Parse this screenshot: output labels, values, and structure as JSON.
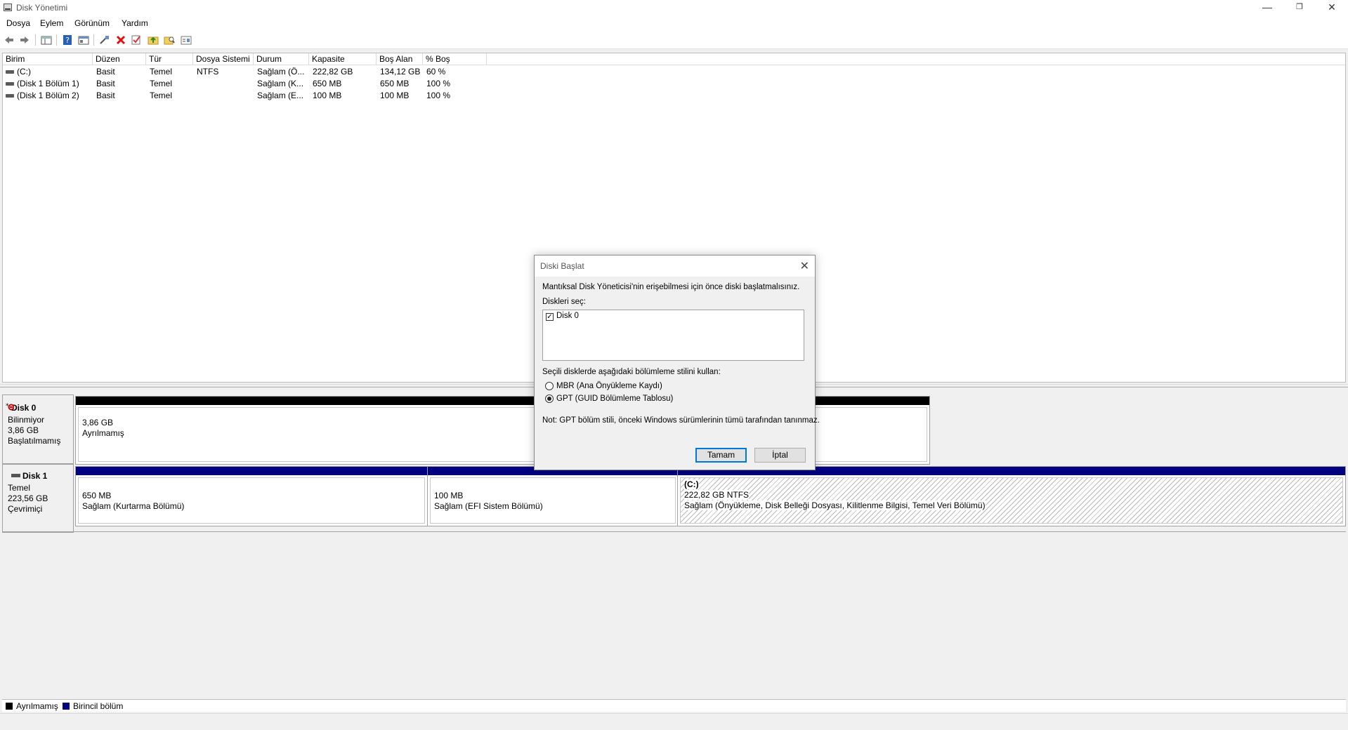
{
  "window": {
    "title": "Disk Yönetimi",
    "minimize_glyph": "—",
    "restore_glyph": "❐",
    "close_glyph": "✕"
  },
  "menu": [
    "Dosya",
    "Eylem",
    "Görünüm",
    "Yardım"
  ],
  "toolbar_icons": [
    "back-icon",
    "forward-icon",
    "console-tree-icon",
    "help-icon",
    "properties-icon",
    "connect-icon",
    "delete-icon",
    "check-icon",
    "up-folder-icon",
    "search-folder-icon",
    "view-icon"
  ],
  "volume_table": {
    "headers": [
      "Birim",
      "Düzen",
      "Tür",
      "Dosya Sistemi",
      "Durum",
      "Kapasite",
      "Boş Alan",
      "% Boş"
    ],
    "rows": [
      [
        "(C:)",
        "Basit",
        "Temel",
        "NTFS",
        "Sağlam (Ö...",
        "222,82 GB",
        "134,12 GB",
        "60 %"
      ],
      [
        "(Disk 1 Bölüm 1)",
        "Basit",
        "Temel",
        "",
        "Sağlam (K...",
        "650 MB",
        "650 MB",
        "100 %"
      ],
      [
        "(Disk 1 Bölüm 2)",
        "Basit",
        "Temel",
        "",
        "Sağlam (E...",
        "100 MB",
        "100 MB",
        "100 %"
      ]
    ]
  },
  "disks": [
    {
      "name": "Disk 0",
      "type": "Bilinmiyor",
      "size": "3,86 GB",
      "status": "Başlatılmamış",
      "partitions": [
        {
          "size": "3,86 GB",
          "label": "Ayrılmamış",
          "kind": "unallocated"
        }
      ]
    },
    {
      "name": "Disk 1",
      "type": "Temel",
      "size": "223,56 GB",
      "status": "Çevrimiçi",
      "partitions": [
        {
          "size": "650 MB",
          "label": "Sağlam (Kurtarma Bölümü)",
          "kind": "primary"
        },
        {
          "size": "100 MB",
          "label": "Sağlam (EFI Sistem Bölümü)",
          "kind": "primary"
        },
        {
          "drive": "(C:)",
          "size": "222,82 GB NTFS",
          "label": "Sağlam (Önyükleme, Disk Belleği Dosyası, Kilitlenme Bilgisi, Temel Veri Bölümü)",
          "kind": "primary"
        }
      ]
    }
  ],
  "legend": [
    {
      "label": "Ayrılmamış",
      "color": "#000000"
    },
    {
      "label": "Birincil bölüm",
      "color": "#000080"
    }
  ],
  "colors": {
    "unallocated": "#000000",
    "primary": "#000080",
    "dialog_accent": "#0078d7"
  },
  "dialog": {
    "title": "Diski Başlat",
    "intro": "Mantıksal Disk Yöneticisi'nin erişebilmesi için önce diski başlatmalısınız.",
    "select_label": "Diskleri seç:",
    "disks": [
      {
        "label": "Disk 0",
        "checked": true
      }
    ],
    "style_label": "Seçili disklerde aşağıdaki bölümleme stilini kullan:",
    "options": [
      {
        "label": "MBR (Ana Önyükleme Kaydı)",
        "selected": false
      },
      {
        "label": "GPT (GUID Bölümleme Tablosu)",
        "selected": true
      }
    ],
    "note": "Not: GPT bölüm stili, önceki Windows sürümlerinin tümü tarafından tanınmaz.",
    "ok": "Tamam",
    "cancel": "İptal"
  }
}
